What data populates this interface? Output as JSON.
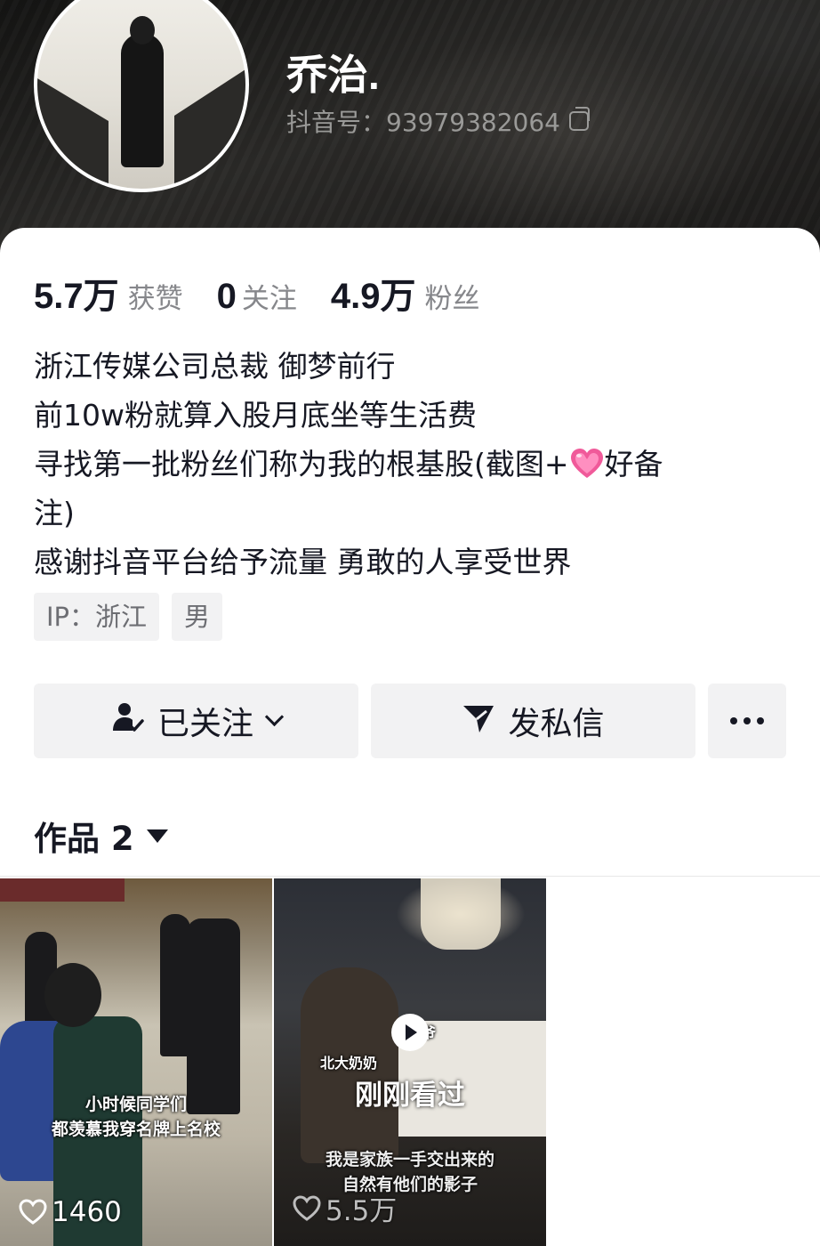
{
  "profile": {
    "name": "乔治.",
    "douyin_id": "抖音号：93979382064"
  },
  "stats": [
    {
      "value": "5.7万",
      "label": "获赞"
    },
    {
      "value": "0",
      "label": "关注"
    },
    {
      "value": "4.9万",
      "label": "粉丝"
    }
  ],
  "bio": {
    "line1": "浙江传媒公司总裁 御梦前行",
    "line2": "前10w粉就算入股月底坐等生活费",
    "line3a": "寻找第一批粉丝们称为我的根基股(截图+",
    "line3b": "好备",
    "line4": "注)",
    "line5": "感谢抖音平台给予流量 勇敢的人享受世界"
  },
  "tags": [
    "IP：浙江",
    "男"
  ],
  "actions": {
    "follow": "已关注",
    "message": "发私信"
  },
  "works": {
    "label": "作品 2"
  },
  "videos": [
    {
      "caption_line1": "小时候同学们",
      "caption_line2": "都羡慕我穿名牌上名校",
      "likes": "1460"
    },
    {
      "overlay": "刚刚看过",
      "caption_line1": "我是家族一手交出来的",
      "caption_line2": "自然有他们的影子",
      "tag_grandma": "北大奶奶",
      "tag_grandpa": "爷爷",
      "likes": "5.5万"
    }
  ],
  "colors": {
    "text_primary": "#161823",
    "text_secondary": "#86878b",
    "button_bg": "#f2f2f3"
  }
}
